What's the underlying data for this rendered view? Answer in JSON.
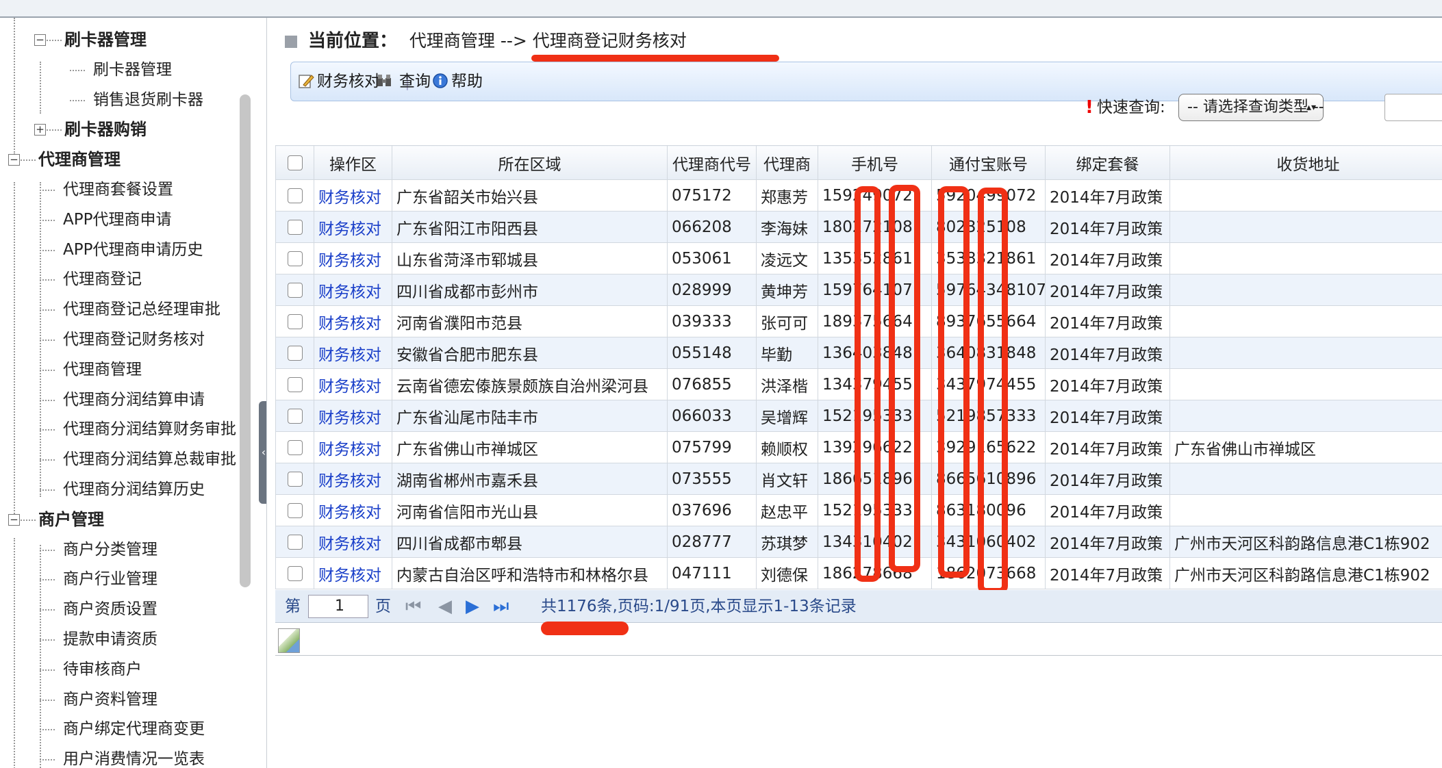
{
  "sidebar": {
    "items": [
      {
        "label": "刷卡器管理",
        "level": 1,
        "toggle": "−"
      },
      {
        "label": "刷卡器管理",
        "level": 2
      },
      {
        "label": "销售退货刷卡器",
        "level": 2
      },
      {
        "label": "刷卡器购销",
        "level": 1,
        "toggle": "+"
      },
      {
        "label": "代理商管理",
        "level": 0,
        "toggle": "−"
      },
      {
        "label": "代理商套餐设置",
        "level": 1
      },
      {
        "label": "APP代理商申请",
        "level": 1
      },
      {
        "label": "APP代理商申请历史",
        "level": 1
      },
      {
        "label": "代理商登记",
        "level": 1
      },
      {
        "label": "代理商登记总经理审批",
        "level": 1
      },
      {
        "label": "代理商登记财务核对",
        "level": 1
      },
      {
        "label": "代理商管理",
        "level": 1
      },
      {
        "label": "代理商分润结算申请",
        "level": 1
      },
      {
        "label": "代理商分润结算财务审批",
        "level": 1
      },
      {
        "label": "代理商分润结算总裁审批",
        "level": 1
      },
      {
        "label": "代理商分润结算历史",
        "level": 1
      },
      {
        "label": "商户管理",
        "level": 0,
        "toggle": "−"
      },
      {
        "label": "商户分类管理",
        "level": 1
      },
      {
        "label": "商户行业管理",
        "level": 1
      },
      {
        "label": "商户资质设置",
        "level": 1
      },
      {
        "label": "提款申请资质",
        "level": 1
      },
      {
        "label": "待审核商户",
        "level": 1
      },
      {
        "label": "商户资料管理",
        "level": 1
      },
      {
        "label": "商户绑定代理商变更",
        "level": 1
      },
      {
        "label": "用户消费情况一览表",
        "level": 1
      }
    ],
    "collapse_glyph": "‹"
  },
  "breadcrumb": {
    "label": "当前位置：",
    "path": "代理商管理 --> 代理商登记财务核对"
  },
  "toolbar": {
    "verify_label": "财务核对",
    "query_label": "查询",
    "help_label": "帮助"
  },
  "quick_search": {
    "mark": "!",
    "label": "快速查询:",
    "select_value": "-- 请选择查询类型 --",
    "select_arrow": "▴▾"
  },
  "grid": {
    "headers": [
      "操作区",
      "所在区域",
      "代理商代号",
      "代理商",
      "手机号",
      "通付宝账号",
      "绑定套餐",
      "收货地址"
    ],
    "rows": [
      {
        "op": "财务核对",
        "area": "广东省韶关市始兴县",
        "code": "075172",
        "name": "郑惠芳",
        "phone": "159249072",
        "account": "5920499072",
        "plan": "2014年7月政策",
        "address": ""
      },
      {
        "op": "财务核对",
        "area": "广东省阳江市阳西县",
        "code": "066208",
        "name": "李海妹",
        "phone": "180272108",
        "account": "802325108",
        "plan": "2014年7月政策",
        "address": ""
      },
      {
        "op": "财务核对",
        "area": "山东省菏泽市郓城县",
        "code": "053061",
        "name": "凌远文",
        "phone": "135352861",
        "account": "3538321861",
        "plan": "2014年7月政策",
        "address": ""
      },
      {
        "op": "财务核对",
        "area": "四川省成都市彭州市",
        "code": "028999",
        "name": "黄坤芳",
        "phone": "159764107",
        "account": "59764348107",
        "plan": "2014年7月政策",
        "address": ""
      },
      {
        "op": "财务核对",
        "area": "河南省濮阳市范县",
        "code": "039333",
        "name": "张可可",
        "phone": "189375664",
        "account": "8937655664",
        "plan": "2014年7月政策",
        "address": ""
      },
      {
        "op": "财务核对",
        "area": "安徽省合肥市肥东县",
        "code": "055148",
        "name": "毕勤",
        "phone": "136403848",
        "account": "3640831848",
        "plan": "2014年7月政策",
        "address": ""
      },
      {
        "op": "财务核对",
        "area": "云南省德宏傣族景颇族自治州梁河县",
        "code": "076855",
        "name": "洪泽楷",
        "phone": "134379455",
        "account": "3437974455",
        "plan": "2014年7月政策",
        "address": ""
      },
      {
        "op": "财务核对",
        "area": "广东省汕尾市陆丰市",
        "code": "066033",
        "name": "吴增辉",
        "phone": "152195333",
        "account": "5219857333",
        "plan": "2014年7月政策",
        "address": ""
      },
      {
        "op": "财务核对",
        "area": "广东省佛山市禅城区",
        "code": "075799",
        "name": "赖顺权",
        "phone": "139296622",
        "account": "3929165622",
        "plan": "2014年7月政策",
        "address": "广东省佛山市禅城区"
      },
      {
        "op": "财务核对",
        "area": "湖南省郴州市嘉禾县",
        "code": "073555",
        "name": "肖文轩",
        "phone": "186651896",
        "account": "8665610896",
        "plan": "2014年7月政策",
        "address": ""
      },
      {
        "op": "财务核对",
        "area": "河南省信阳市光山县",
        "code": "037696",
        "name": "赵忠平",
        "phone": "152195333",
        "account": "863180096",
        "plan": "2014年7月政策",
        "address": ""
      },
      {
        "op": "财务核对",
        "area": "四川省成都市郫县",
        "code": "028777",
        "name": "苏琪梦",
        "phone": "134310402",
        "account": "3431060402",
        "plan": "2014年7月政策",
        "address": "广州市天河区科韵路信息港C1栋902"
      },
      {
        "op": "财务核对",
        "area": "内蒙古自治区呼和浩特市和林格尔县",
        "code": "047111",
        "name": "刘德保",
        "phone": "186278668",
        "account": "1862073668",
        "plan": "2014年7月政策",
        "address": "广州市天河区科韵路信息港C1栋902"
      }
    ]
  },
  "pager": {
    "prefix": "第",
    "page": "1",
    "suffix": "页",
    "first": "⏮",
    "prev": "◀",
    "next": "▶",
    "last": "⏭",
    "summary": "共1176条,页码:1/91页,本页显示1-13条记录"
  },
  "colors": {
    "annotation_red": "#f03015",
    "link_blue": "#1a3fc9",
    "row_stripe": "#edf3fb"
  }
}
